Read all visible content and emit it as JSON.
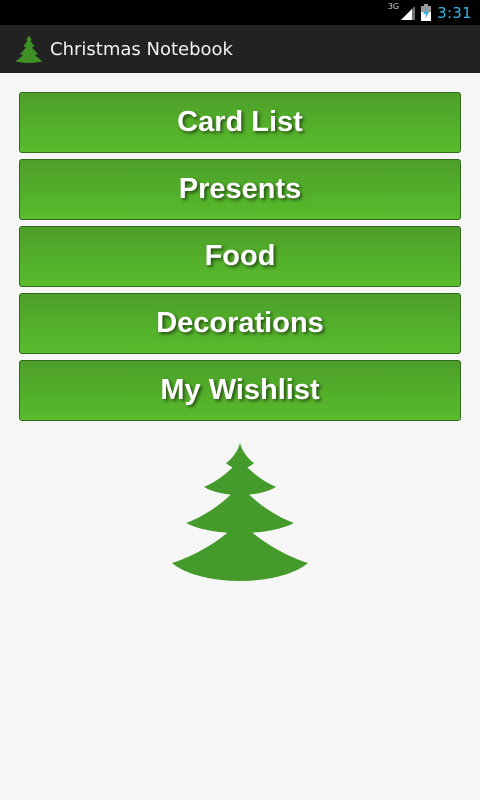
{
  "status_bar": {
    "network_type": "3G",
    "time": "3:31"
  },
  "action_bar": {
    "title": "Christmas Notebook",
    "icon": "christmas-tree-icon"
  },
  "menu": {
    "buttons": [
      {
        "label": "Card List"
      },
      {
        "label": "Presents"
      },
      {
        "label": "Food"
      },
      {
        "label": "Decorations"
      },
      {
        "label": "My Wishlist"
      }
    ]
  },
  "colors": {
    "accent_green": "#52ad2a",
    "tree_green": "#3f8f27",
    "clock_blue": "#33b5e5"
  },
  "illustration": {
    "icon": "christmas-tree-icon"
  }
}
